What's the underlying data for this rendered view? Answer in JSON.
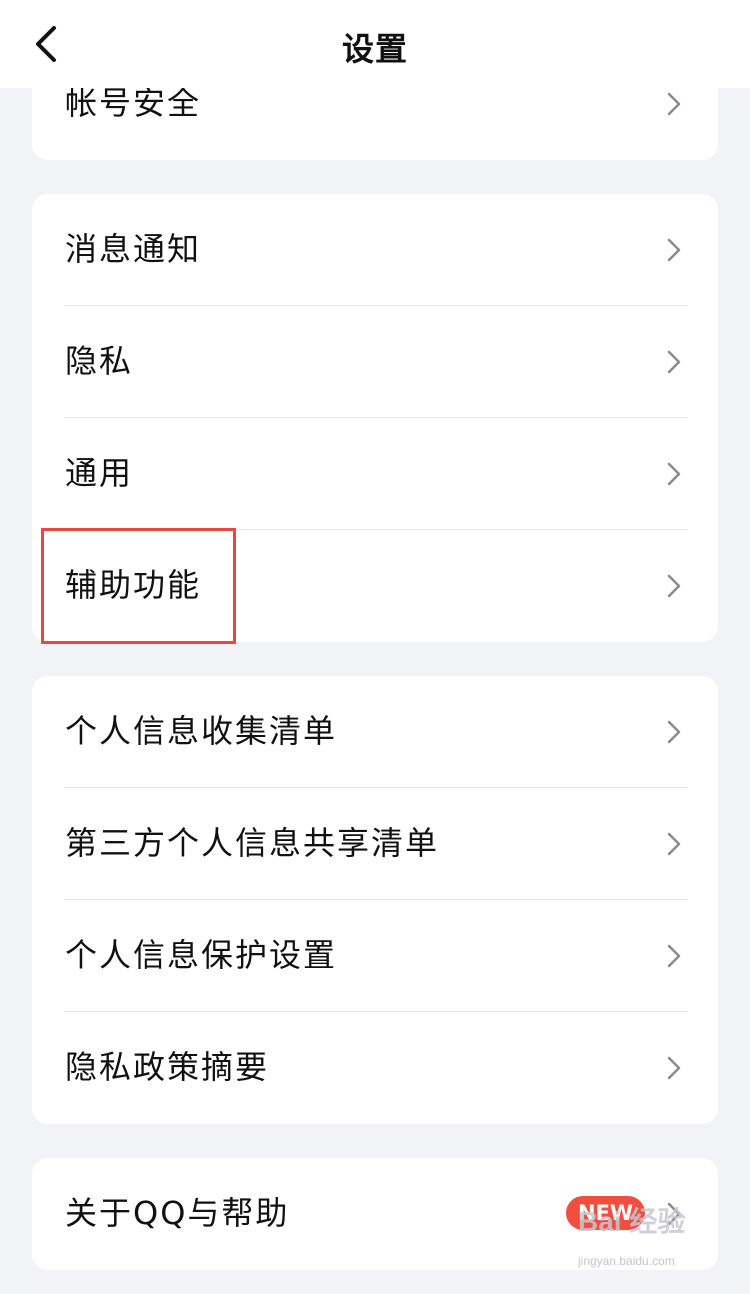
{
  "header": {
    "title": "设置"
  },
  "sections": [
    {
      "items": [
        {
          "label": "帐号安全"
        }
      ]
    },
    {
      "items": [
        {
          "label": "消息通知"
        },
        {
          "label": "隐私"
        },
        {
          "label": "通用"
        },
        {
          "label": "辅助功能",
          "highlighted": true
        }
      ]
    },
    {
      "items": [
        {
          "label": "个人信息收集清单"
        },
        {
          "label": "第三方个人信息共享清单"
        },
        {
          "label": "个人信息保护设置"
        },
        {
          "label": "隐私政策摘要"
        }
      ]
    },
    {
      "items": [
        {
          "label": "关于QQ与帮助",
          "badge": "NEW"
        }
      ]
    }
  ],
  "watermark": {
    "brand": "Bai 经验",
    "url": "jingyan.baidu.com"
  },
  "colors": {
    "background": "#f2f3f7",
    "card": "#ffffff",
    "highlight": "#e8483f",
    "badge": "#f04e3e",
    "chevron": "#8a8a90"
  },
  "icons": {
    "back": "chevron-left-icon",
    "row_arrow": "chevron-right-icon"
  }
}
